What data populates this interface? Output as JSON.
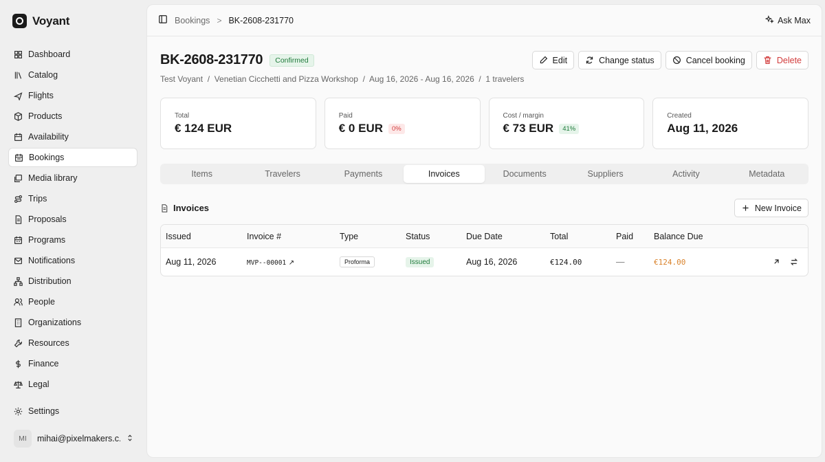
{
  "app": {
    "name": "Voyant"
  },
  "nav": [
    {
      "label": "Dashboard",
      "icon": "dashboard-icon"
    },
    {
      "label": "Catalog",
      "icon": "library-icon"
    },
    {
      "label": "Flights",
      "icon": "plane-icon"
    },
    {
      "label": "Products",
      "icon": "package-icon"
    },
    {
      "label": "Availability",
      "icon": "calendar-icon"
    },
    {
      "label": "Bookings",
      "icon": "calendar-check-icon"
    },
    {
      "label": "Media library",
      "icon": "images-icon"
    },
    {
      "label": "Trips",
      "icon": "route-icon"
    },
    {
      "label": "Proposals",
      "icon": "file-icon"
    },
    {
      "label": "Programs",
      "icon": "calendar-icon"
    },
    {
      "label": "Notifications",
      "icon": "mail-icon"
    },
    {
      "label": "Distribution",
      "icon": "network-icon"
    },
    {
      "label": "People",
      "icon": "users-icon"
    },
    {
      "label": "Organizations",
      "icon": "building-icon"
    },
    {
      "label": "Resources",
      "icon": "wrench-icon"
    },
    {
      "label": "Finance",
      "icon": "dollar-icon"
    },
    {
      "label": "Legal",
      "icon": "scale-icon"
    }
  ],
  "settings": {
    "label": "Settings"
  },
  "user": {
    "initials": "MI",
    "email": "mihai@pixelmakers.c..."
  },
  "breadcrumb": {
    "parent": "Bookings",
    "separator": ">",
    "current": "BK-2608-231770"
  },
  "ask": {
    "label": "Ask Max"
  },
  "booking": {
    "id": "BK-2608-231770",
    "status": "Confirmed",
    "subline": "Test Voyant  /  Venetian Cicchetti and Pizza Workshop  /  Aug 16, 2026 - Aug 16, 2026  /  1 travelers"
  },
  "actions": {
    "edit": "Edit",
    "change_status": "Change status",
    "cancel": "Cancel booking",
    "delete": "Delete"
  },
  "stats": {
    "total": {
      "label": "Total",
      "value": "€ 124 EUR"
    },
    "paid": {
      "label": "Paid",
      "value": "€ 0 EUR",
      "pill": "0%"
    },
    "cost": {
      "label": "Cost / margin",
      "value": "€ 73 EUR",
      "pill": "41%"
    },
    "created": {
      "label": "Created",
      "value": "Aug 11, 2026"
    }
  },
  "tabs": [
    "Items",
    "Travelers",
    "Payments",
    "Invoices",
    "Documents",
    "Suppliers",
    "Activity",
    "Metadata"
  ],
  "active_tab": "Invoices",
  "invoices": {
    "title": "Invoices",
    "new_label": "New Invoice",
    "columns": [
      "Issued",
      "Invoice #",
      "Type",
      "Status",
      "Due Date",
      "Total",
      "Paid",
      "Balance Due"
    ],
    "rows": [
      {
        "issued": "Aug 11, 2026",
        "number": "MVP--00001",
        "type": "Proforma",
        "status": "Issued",
        "due": "Aug 16, 2026",
        "total": "€124.00",
        "paid": "—",
        "balance": "€124.00"
      }
    ]
  },
  "colors": {
    "success": "#1e7a3a",
    "danger": "#d23c3c",
    "balance": "#d9822b"
  }
}
